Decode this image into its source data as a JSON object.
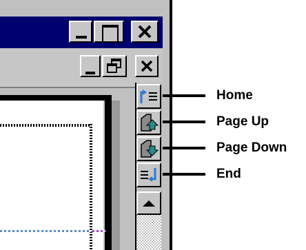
{
  "window": {
    "title_buttons": [
      "minimize-icon",
      "maximize-icon",
      "close-icon"
    ],
    "document_buttons": [
      "minimize-icon",
      "restore-icon",
      "close-icon"
    ]
  },
  "scroll_buttons": [
    {
      "icon": "home-icon",
      "label": "Home"
    },
    {
      "icon": "page-up-icon",
      "label": "Page Up"
    },
    {
      "icon": "page-down-icon",
      "label": "Page Down"
    },
    {
      "icon": "end-icon",
      "label": "End"
    },
    {
      "icon": "scroll-up-arrow-icon"
    }
  ],
  "colors": {
    "titlebar": "#00006e",
    "button_face": "#c6c6c6",
    "accent_blue": "#2a7ad6",
    "accent_teal": "#2a8a8a"
  }
}
